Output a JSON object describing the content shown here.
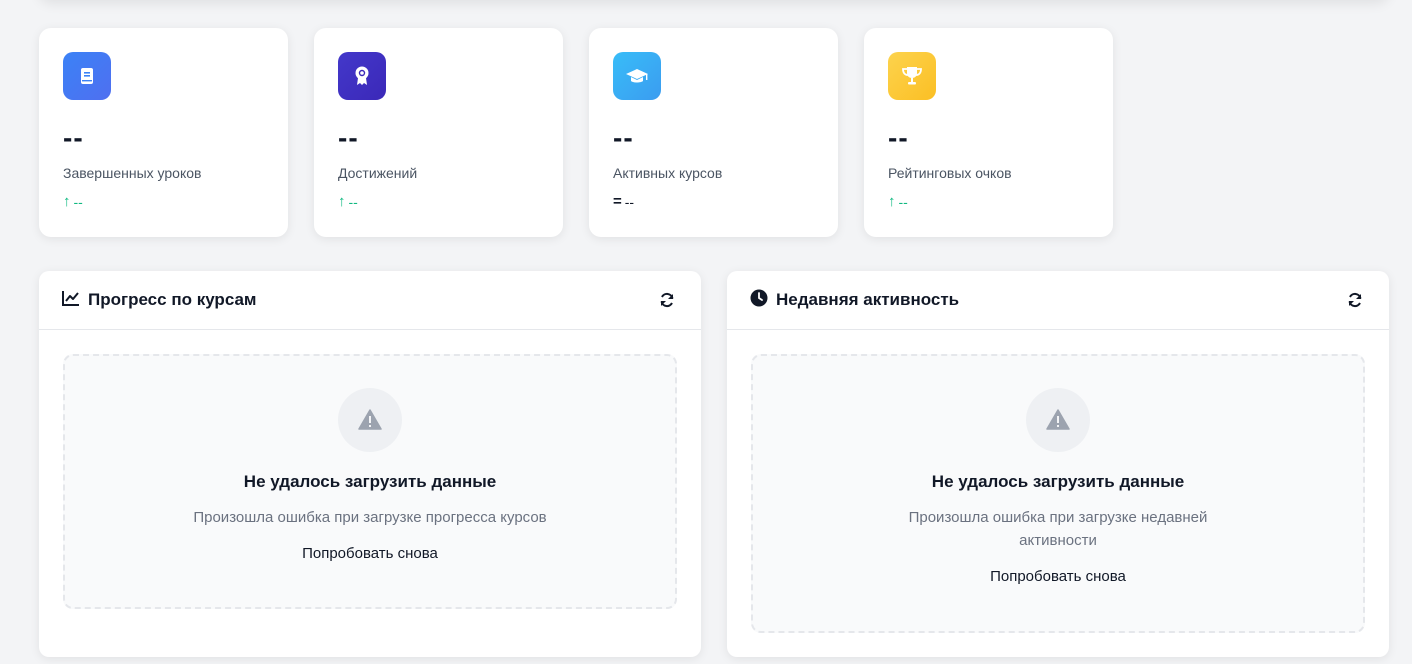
{
  "stats": [
    {
      "icon": "book-icon",
      "color_from": "#3b82f6",
      "color_to": "#4f6ff0",
      "value": "--",
      "label": "Завершенных уроков",
      "trend_arrow": "↑",
      "trend_value": "--",
      "trend": "up"
    },
    {
      "icon": "award-icon",
      "color_from": "#4338ca",
      "color_to": "#3b28b8",
      "value": "--",
      "label": "Достижений",
      "trend_arrow": "↑",
      "trend_value": "--",
      "trend": "up"
    },
    {
      "icon": "graduation-cap-icon",
      "color_from": "#38bdf8",
      "color_to": "#3b9cf0",
      "value": "--",
      "label": "Активных курсов",
      "trend_arrow": "=",
      "trend_value": "--",
      "trend": "neutral"
    },
    {
      "icon": "trophy-icon",
      "color_from": "#fcd34d",
      "color_to": "#fbbf24",
      "value": "--",
      "label": "Рейтинговых очков",
      "trend_arrow": "↑",
      "trend_value": "--",
      "trend": "up"
    }
  ],
  "panels": {
    "progress": {
      "title": "Прогресс по курсам",
      "icon": "line-chart-icon",
      "error_title": "Не удалось загрузить данные",
      "error_desc": "Произошла ошибка при загрузке прогресса курсов",
      "retry_label": "Попробовать снова"
    },
    "activity": {
      "title": "Недавняя активность",
      "icon": "clock-icon",
      "error_title": "Не удалось загрузить данные",
      "error_desc": "Произошла ошибка при загрузке недавней активности",
      "retry_label": "Попробовать снова"
    }
  },
  "colors": {
    "trend_up": "#10b981",
    "page_bg": "#f3f4f6",
    "warning_icon": "#9ca3af"
  }
}
